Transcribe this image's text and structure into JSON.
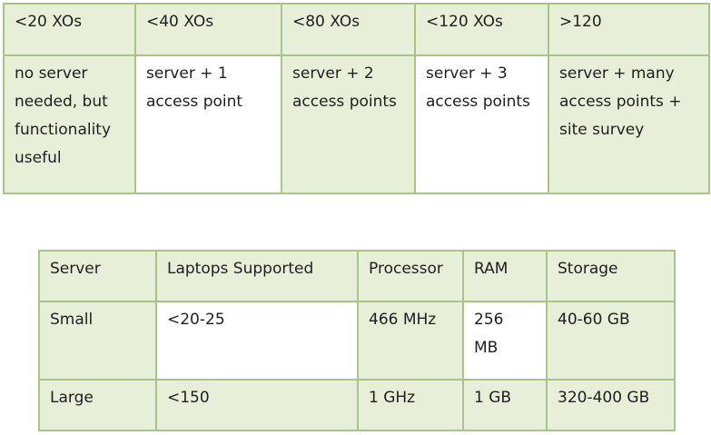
{
  "capacity_table": {
    "headers": [
      "<20 XOs",
      "<40 XOs",
      "<80 XOs",
      "<120 XOs",
      ">120"
    ],
    "cells": [
      "no server\nneeded, but\nfunctionality\nuseful",
      "server + 1\naccess point",
      "server + 2\naccess points",
      "server + 3\naccess points",
      "server + many\naccess points +\nsite survey"
    ]
  },
  "server_table": {
    "headers": [
      "Server",
      "Laptops Supported",
      "Processor",
      "RAM",
      "Storage"
    ],
    "rows": [
      [
        "Small",
        "<20-25",
        "466 MHz",
        "256\nMB",
        "40-60 GB"
      ],
      [
        "Large",
        "<150",
        "1 GHz",
        "1 GB",
        "320-400 GB"
      ]
    ]
  },
  "colors": {
    "green_fill": "#e7efd9",
    "border": "#a9c487"
  }
}
